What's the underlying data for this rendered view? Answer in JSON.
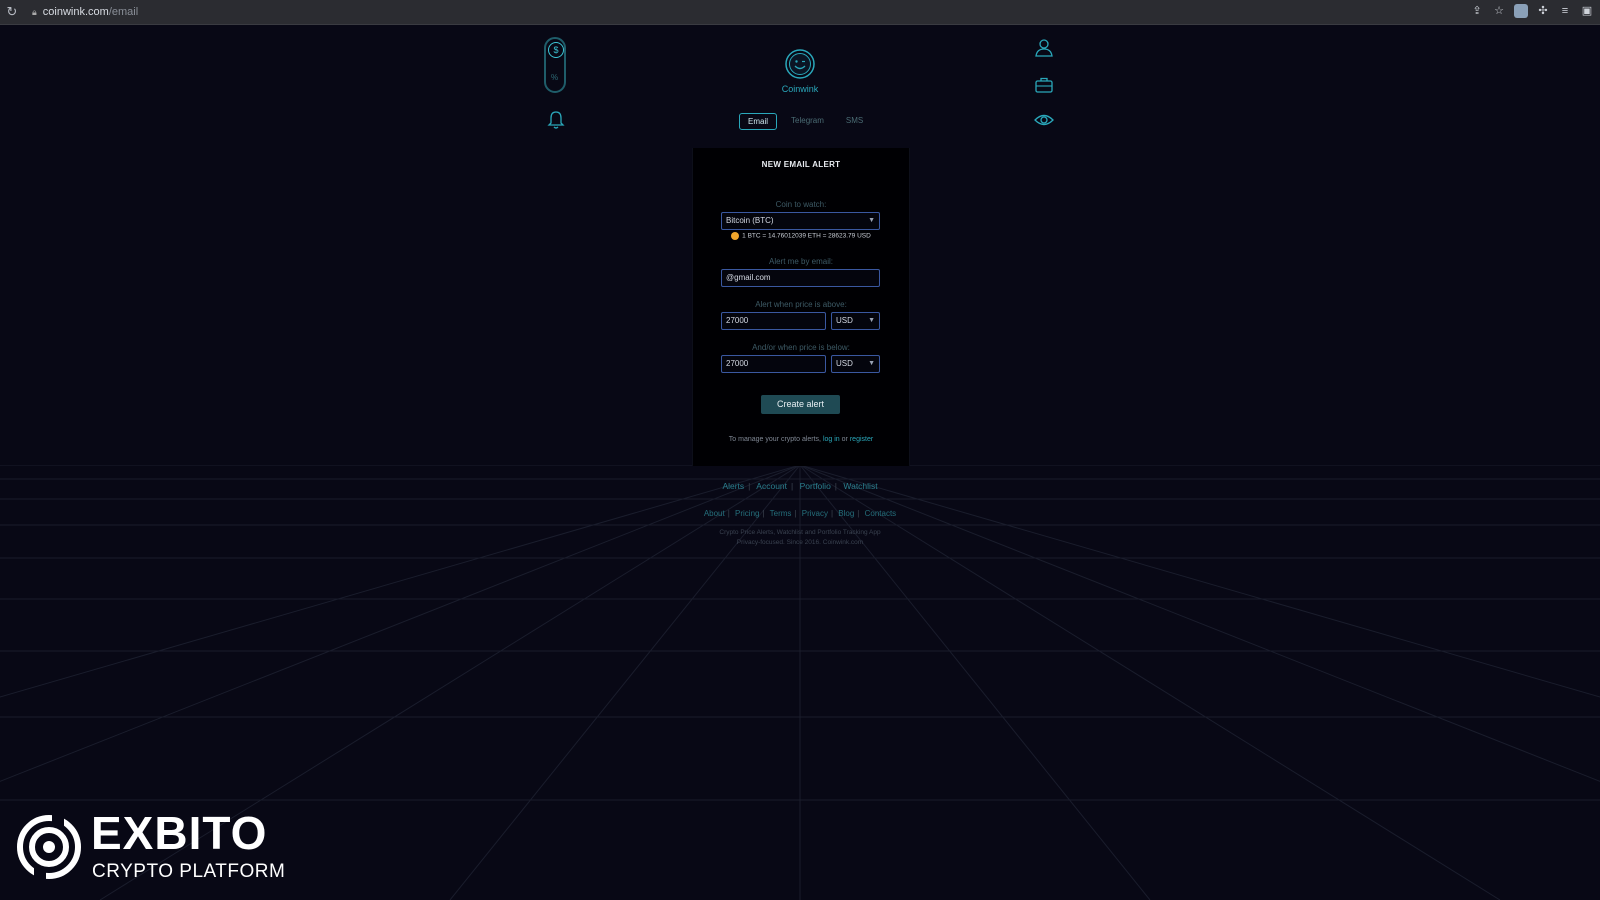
{
  "browser": {
    "url_domain": "coinwink.com",
    "url_path": "/email"
  },
  "nav": {
    "left_icons": [
      "currency-toggle-icon",
      "bell-icon"
    ],
    "right_icons": [
      "user-icon",
      "briefcase-icon",
      "eye-icon"
    ],
    "toggle_symbol": "$",
    "toggle_secondary": "%"
  },
  "brand": {
    "name": "Coinwink"
  },
  "tabs": [
    {
      "label": "Email",
      "active": true
    },
    {
      "label": "Telegram",
      "active": false
    },
    {
      "label": "SMS",
      "active": false
    }
  ],
  "form": {
    "title": "NEW EMAIL ALERT",
    "coin_label": "Coin to watch:",
    "coin_value": "Bitcoin (BTC)",
    "rate_text": "1 BTC = 14.76012039 ETH = 28623.79 USD",
    "email_label": "Alert me by email:",
    "email_value": "@gmail.com",
    "above_label": "Alert when price is above:",
    "above_value": "27000",
    "above_currency": "USD",
    "below_label": "And/or when price is below:",
    "below_value": "27000",
    "below_currency": "USD",
    "submit_label": "Create alert",
    "manage_prefix": "To manage your crypto alerts,",
    "manage_login": "log in",
    "manage_or": "or",
    "manage_register": "register"
  },
  "footer": {
    "primary_links": [
      "Alerts",
      "Account",
      "Portfolio",
      "Watchlist"
    ],
    "secondary_links": [
      "About",
      "Pricing",
      "Terms",
      "Privacy",
      "Blog",
      "Contacts"
    ],
    "copyright_line1": "Crypto Price Alerts, Watchlist and Portfolio Tracking App",
    "copyright_line2": "Privacy-focused. Since 2016. Coinwink.com"
  },
  "watermark": {
    "name": "EXBITO",
    "tagline": "CRYPTO PLATFORM"
  },
  "colors": {
    "background": "#080815",
    "accent": "#2aa8bb",
    "button": "#1f4a54",
    "field_border": "#3a58a0"
  }
}
